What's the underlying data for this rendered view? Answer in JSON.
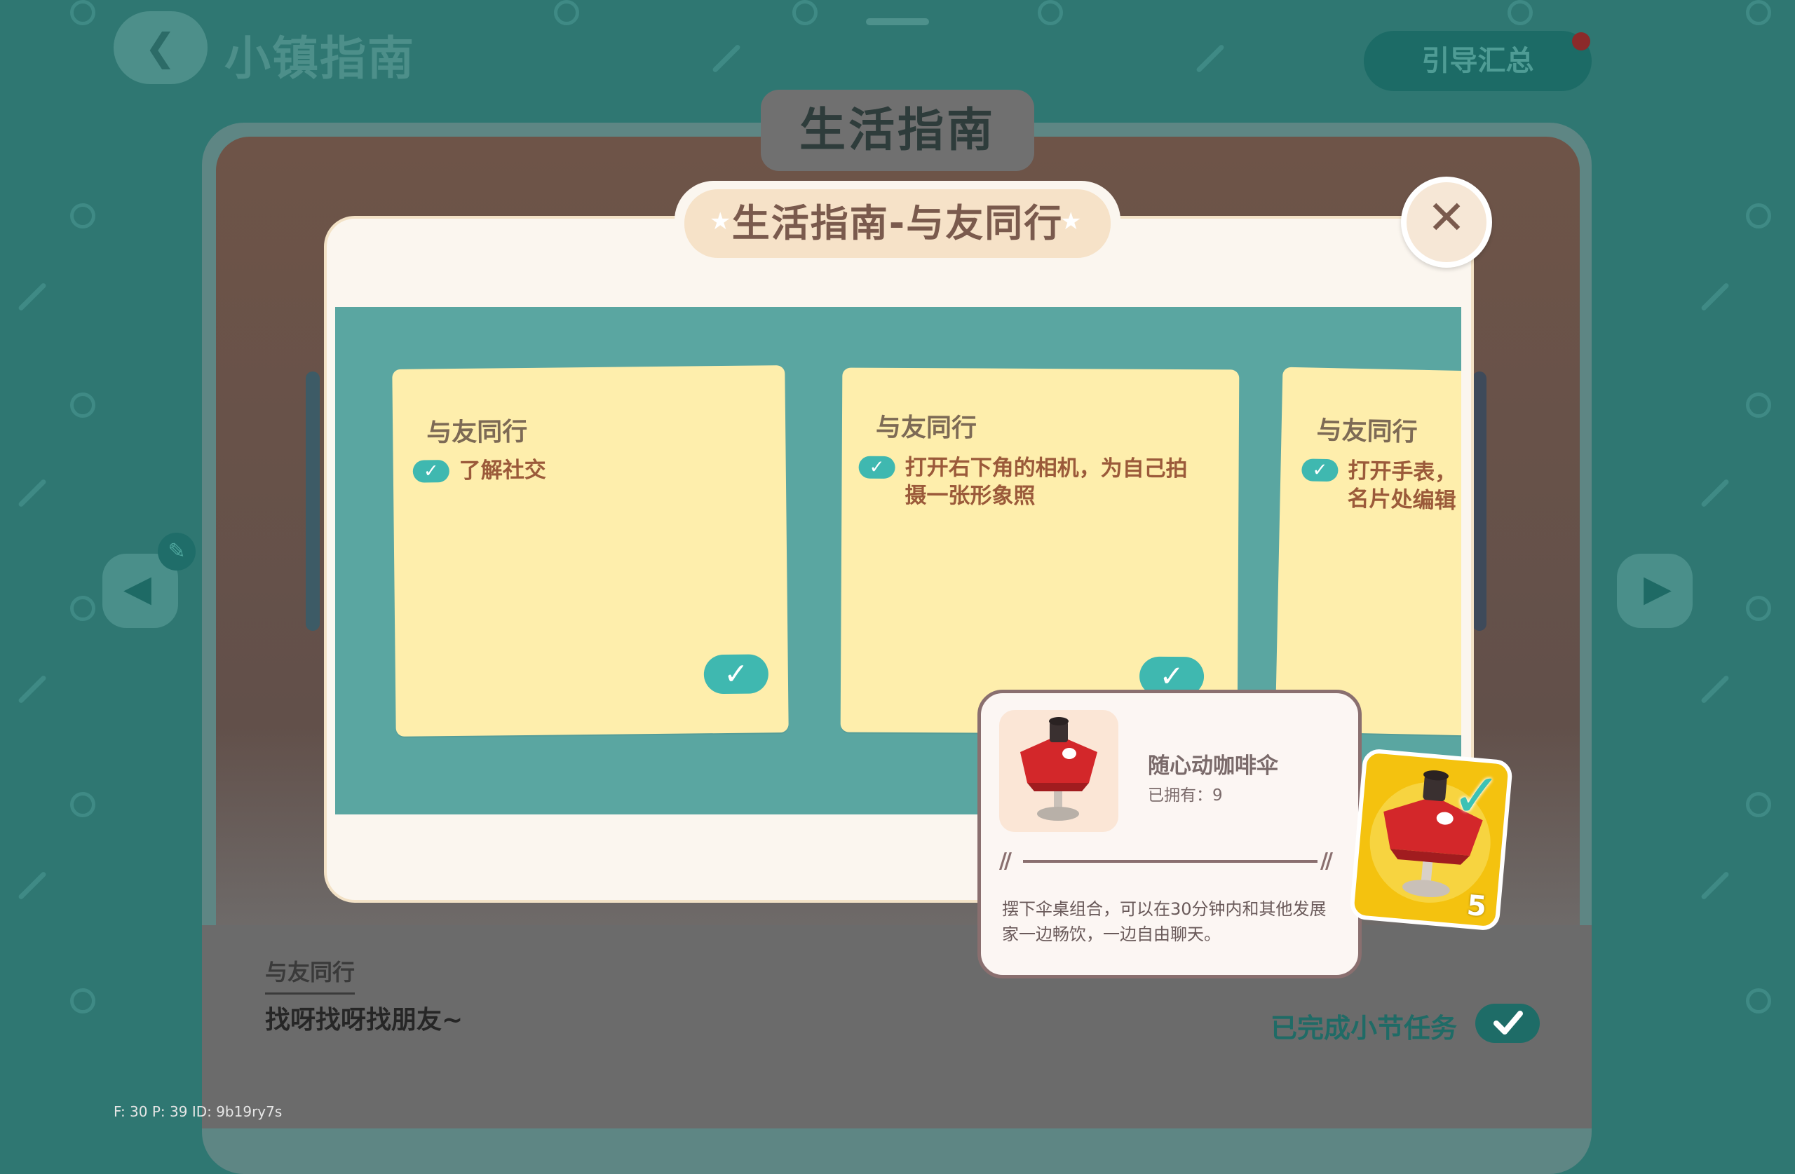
{
  "colors": {
    "background": "#2f7772",
    "teal_band": "#5aa6a1",
    "note_yellow": "#feeeac",
    "check_teal": "#3fb8b0",
    "text_brown": "#7a5a4d",
    "reward_gold": "#f4c20f"
  },
  "header": {
    "back_icon": "chevron-left-icon",
    "title": "小镇指南",
    "summary_button": "引导汇总",
    "has_notification_dot": true
  },
  "book": {
    "tab_title": "生活指南",
    "section_label": "与友同行",
    "section_subtitle": "找呀找呀找朋友~",
    "completed_text": "已完成小节任务"
  },
  "modal": {
    "title": "生活指南-与友同行",
    "close_icon": "close-icon",
    "cards": [
      {
        "title": "与友同行",
        "line1": "了解社交",
        "line2": "",
        "completed": true
      },
      {
        "title": "与友同行",
        "line1": "打开右下角的相机，为自己拍",
        "line2": "摄一张形象照",
        "completed": true
      },
      {
        "title": "与友同行",
        "line1": "打开手表，",
        "line2": "名片处编辑",
        "completed": true
      }
    ]
  },
  "tooltip": {
    "item_name": "随心动咖啡伞",
    "owned": "已拥有：9",
    "desc_line1": "摆下伞桌组合，可以在30分钟内和其他发展",
    "desc_line2": "家一边畅饮，一边自由聊天。"
  },
  "reward": {
    "count": "5",
    "claimed": true
  },
  "debug": {
    "text": "F: 30    P: 39    ID: 9b19ry7s"
  }
}
